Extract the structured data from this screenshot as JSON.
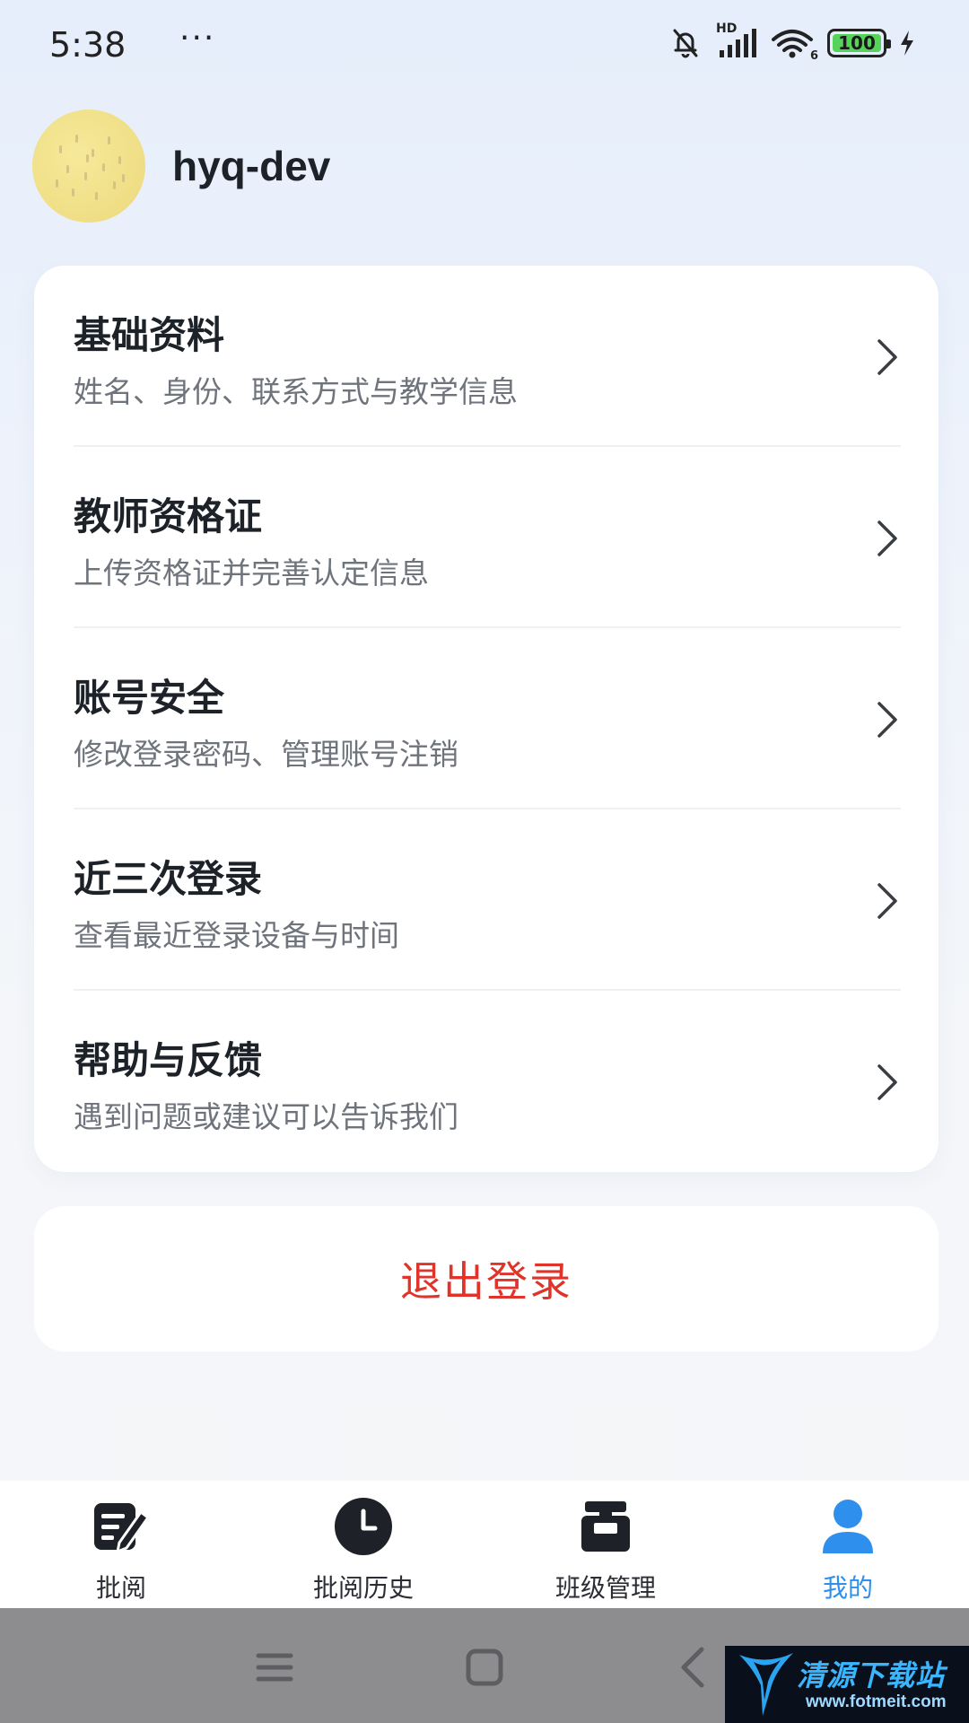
{
  "status_bar": {
    "time": "5:38",
    "more_dots": "···",
    "battery_level": "100",
    "network_label": "HD",
    "wifi_band": "6",
    "icons": [
      "bell-muted-icon",
      "signal-icon",
      "wifi-icon",
      "battery-icon",
      "charging-icon"
    ]
  },
  "profile": {
    "username": "hyq-dev"
  },
  "menu": {
    "items": [
      {
        "title": "基础资料",
        "desc": "姓名、身份、联系方式与教学信息"
      },
      {
        "title": "教师资格证",
        "desc": "上传资格证并完善认定信息"
      },
      {
        "title": "账号安全",
        "desc": "修改登录密码、管理账号注销"
      },
      {
        "title": "近三次登录",
        "desc": "查看最近登录设备与时间"
      },
      {
        "title": "帮助与反馈",
        "desc": "遇到问题或建议可以告诉我们"
      }
    ]
  },
  "logout": {
    "label": "退出登录",
    "color": "#e0342b"
  },
  "tab_bar": {
    "active_color": "#2f8fec",
    "tabs": [
      {
        "label": "批阅",
        "icon": "edit-note-icon",
        "active": false
      },
      {
        "label": "批阅历史",
        "icon": "clock-icon",
        "active": false
      },
      {
        "label": "班级管理",
        "icon": "class-manage-icon",
        "active": false
      },
      {
        "label": "我的",
        "icon": "user-icon",
        "active": true
      }
    ]
  },
  "watermark": {
    "text": "清源下载站",
    "url": "www.fotmeit.com"
  }
}
